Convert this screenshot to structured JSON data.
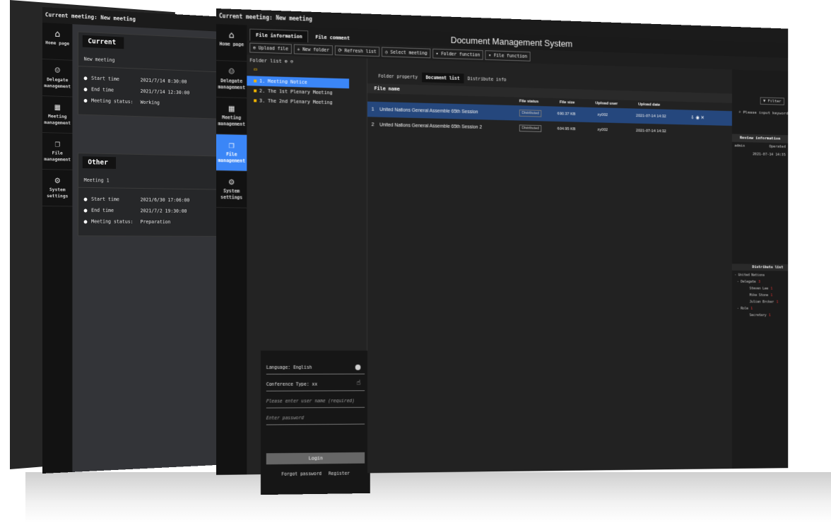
{
  "mid": {
    "topbar": "Current meeting: New meeting",
    "sidebar": [
      {
        "icon": "home-icon",
        "glyph": "⌂",
        "label": "Home page"
      },
      {
        "icon": "delegate-icon",
        "glyph": "☺",
        "label": "Delegate management"
      },
      {
        "icon": "calendar-icon",
        "glyph": "▦",
        "label": "Meeting management"
      },
      {
        "icon": "file-icon",
        "glyph": "❐",
        "label": "File management"
      },
      {
        "icon": "settings-icon",
        "glyph": "⚙",
        "label": "System settings"
      }
    ],
    "current": {
      "title": "Current",
      "meeting": "New meeting",
      "start_label": "Start time",
      "start": "2021/7/14 8:30:00",
      "end_label": "End time",
      "end": "2021/7/14 12:30:00",
      "status_label": "Meeting status:",
      "status": "Working"
    },
    "other": {
      "title": "Other",
      "meeting": "Meeting 1",
      "start_label": "Start time",
      "start": "2021/6/30 17:06:00",
      "end_label": "End time",
      "end": "2021/7/2 19:30:00",
      "status_label": "Meeting status:",
      "status": "Preparation"
    }
  },
  "front": {
    "topbar": "Current meeting: New meeting",
    "system_title": "Document Management System",
    "tabs": [
      "File information",
      "File comment"
    ],
    "toolbar": [
      "Upload file",
      "New folder",
      "Refresh list",
      "Select meeting",
      "Folder function",
      "File function"
    ],
    "user": "admin",
    "folder_list_label": "Folder list",
    "folders": [
      "1. Meeting Notice",
      "2. The 1st Plenary Meeting",
      "3. The 2nd Plenary Meeting"
    ],
    "login": {
      "language": "Language: English",
      "conference": "Conference Type: xx",
      "username_placeholder": "Please enter user name (required)",
      "password_placeholder": "Enter password",
      "button": "Login",
      "forgot": "Forgot password",
      "register": "Register"
    },
    "doc_tabs": [
      "Folder property",
      "Document list",
      "Distribute info"
    ],
    "doc_head": "File name",
    "col_heads": [
      "File status",
      "File size",
      "Upload user",
      "Upload date"
    ],
    "files": [
      {
        "num": "1",
        "name": "United Nations General Assemble 65th Session",
        "status": "Distributed",
        "size": "690.37 KB",
        "user": "zy002",
        "date": "2021-07-14 14:32"
      },
      {
        "num": "2",
        "name": "United Nations General Assemble 65th Session 2",
        "status": "Distributed",
        "size": "604.95 KB",
        "user": "zy002",
        "date": "2021-07-14 14:32"
      }
    ],
    "right": {
      "search_placeholder": "Please input keyword",
      "filter": "Filter",
      "review_head": "Review information",
      "review_user": "admin",
      "review_status": "Operated",
      "review_date": "2021-07-14 14:35",
      "dist_head": "Distribute list",
      "dist": [
        {
          "label": "United Nations",
          "count": ""
        },
        {
          "label": "Delegate",
          "count": "3"
        },
        {
          "label": "Steven Lee",
          "count": "1"
        },
        {
          "label": "Mike Stone",
          "count": "1"
        },
        {
          "label": "Julian Brcker",
          "count": "1"
        },
        {
          "label": "Role",
          "count": "1"
        },
        {
          "label": "Secretary",
          "count": "1"
        }
      ]
    }
  }
}
